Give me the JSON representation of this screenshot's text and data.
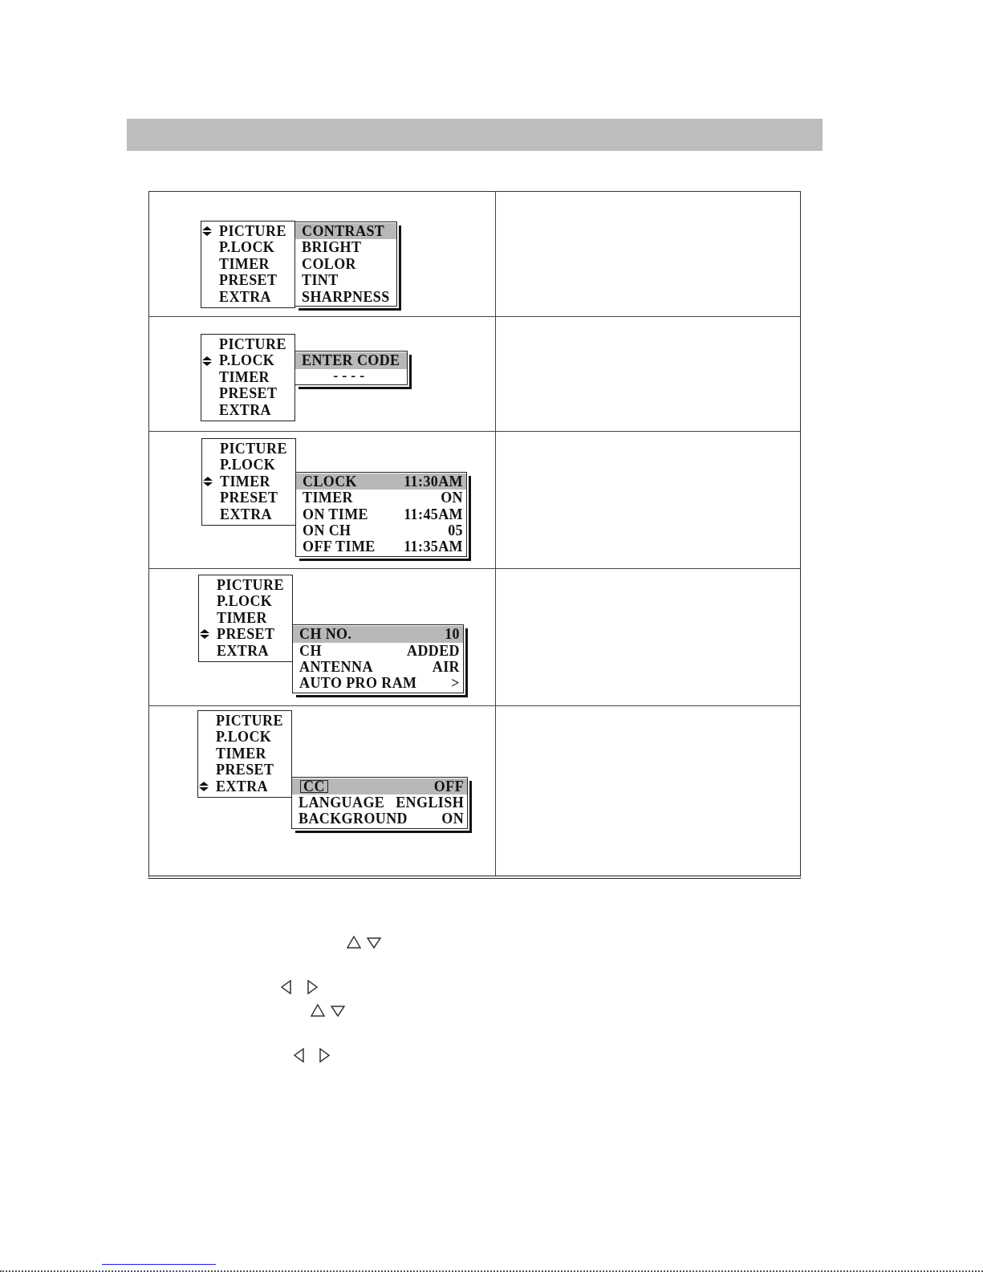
{
  "menu_table": {
    "rows": [
      {
        "main_menu": [
          {
            "label": "PICTURE",
            "selected": true
          },
          {
            "label": "P.LOCK",
            "selected": false
          },
          {
            "label": "TIMER",
            "selected": false
          },
          {
            "label": "PRESET",
            "selected": false
          },
          {
            "label": "EXTRA",
            "selected": false
          }
        ],
        "submenu": [
          {
            "kind": "option",
            "label": "CONTRAST",
            "selected": true
          },
          {
            "kind": "option",
            "label": "BRIGHT",
            "selected": false
          },
          {
            "kind": "option",
            "label": "COLOR",
            "selected": false
          },
          {
            "kind": "option",
            "label": "TINT",
            "selected": false
          },
          {
            "kind": "option",
            "label": "SHARPNESS",
            "selected": false
          }
        ]
      },
      {
        "main_menu": [
          {
            "label": "PICTURE",
            "selected": false
          },
          {
            "label": "P.LOCK",
            "selected": true
          },
          {
            "label": "TIMER",
            "selected": false
          },
          {
            "label": "PRESET",
            "selected": false
          },
          {
            "label": "EXTRA",
            "selected": false
          }
        ],
        "submenu": [
          {
            "kind": "option",
            "label": "ENTER CODE",
            "selected": true
          },
          {
            "kind": "entry",
            "value": "----",
            "selected": false
          }
        ]
      },
      {
        "main_menu": [
          {
            "label": "PICTURE",
            "selected": false
          },
          {
            "label": "P.LOCK",
            "selected": false
          },
          {
            "label": "TIMER",
            "selected": true
          },
          {
            "label": "PRESET",
            "selected": false
          },
          {
            "label": "EXTRA",
            "selected": false
          }
        ],
        "submenu": [
          {
            "kind": "setting",
            "label": "CLOCK",
            "value": "11:30AM",
            "selected": true
          },
          {
            "kind": "setting",
            "label": "TIMER",
            "value": "ON",
            "selected": false
          },
          {
            "kind": "setting",
            "label": "ON TIME",
            "value": "11:45AM",
            "selected": false
          },
          {
            "kind": "setting",
            "label": "ON CH",
            "value": "05",
            "selected": false
          },
          {
            "kind": "setting",
            "label": "OFF TIME",
            "value": "11:35AM",
            "selected": false
          }
        ]
      },
      {
        "main_menu": [
          {
            "label": "PICTURE",
            "selected": false
          },
          {
            "label": "P.LOCK",
            "selected": false
          },
          {
            "label": "TIMER",
            "selected": false
          },
          {
            "label": "PRESET",
            "selected": true
          },
          {
            "label": "EXTRA",
            "selected": false
          }
        ],
        "submenu": [
          {
            "kind": "setting",
            "label": "CH NO.",
            "value": "10",
            "selected": true
          },
          {
            "kind": "setting",
            "label": "CH",
            "value": "ADDED",
            "selected": false
          },
          {
            "kind": "setting",
            "label": "ANTENNA",
            "value": "AIR",
            "selected": false
          },
          {
            "kind": "setting",
            "label": "AUTO PRO RAM",
            "value": ">",
            "selected": false
          }
        ]
      },
      {
        "main_menu": [
          {
            "label": "PICTURE",
            "selected": false
          },
          {
            "label": "P.LOCK",
            "selected": false
          },
          {
            "label": "TIMER",
            "selected": false
          },
          {
            "label": "PRESET",
            "selected": false
          },
          {
            "label": "EXTRA",
            "selected": true
          }
        ],
        "submenu": [
          {
            "kind": "setting",
            "label": "CC",
            "value": "OFF",
            "selected": true,
            "outlined": true
          },
          {
            "kind": "setting",
            "label": "LANGUAGE",
            "value": "ENGLISH",
            "selected": false,
            "outlined": false
          },
          {
            "kind": "setting",
            "label": "BACKGROUND",
            "value": "ON",
            "selected": false,
            "outlined": false
          }
        ]
      }
    ]
  }
}
